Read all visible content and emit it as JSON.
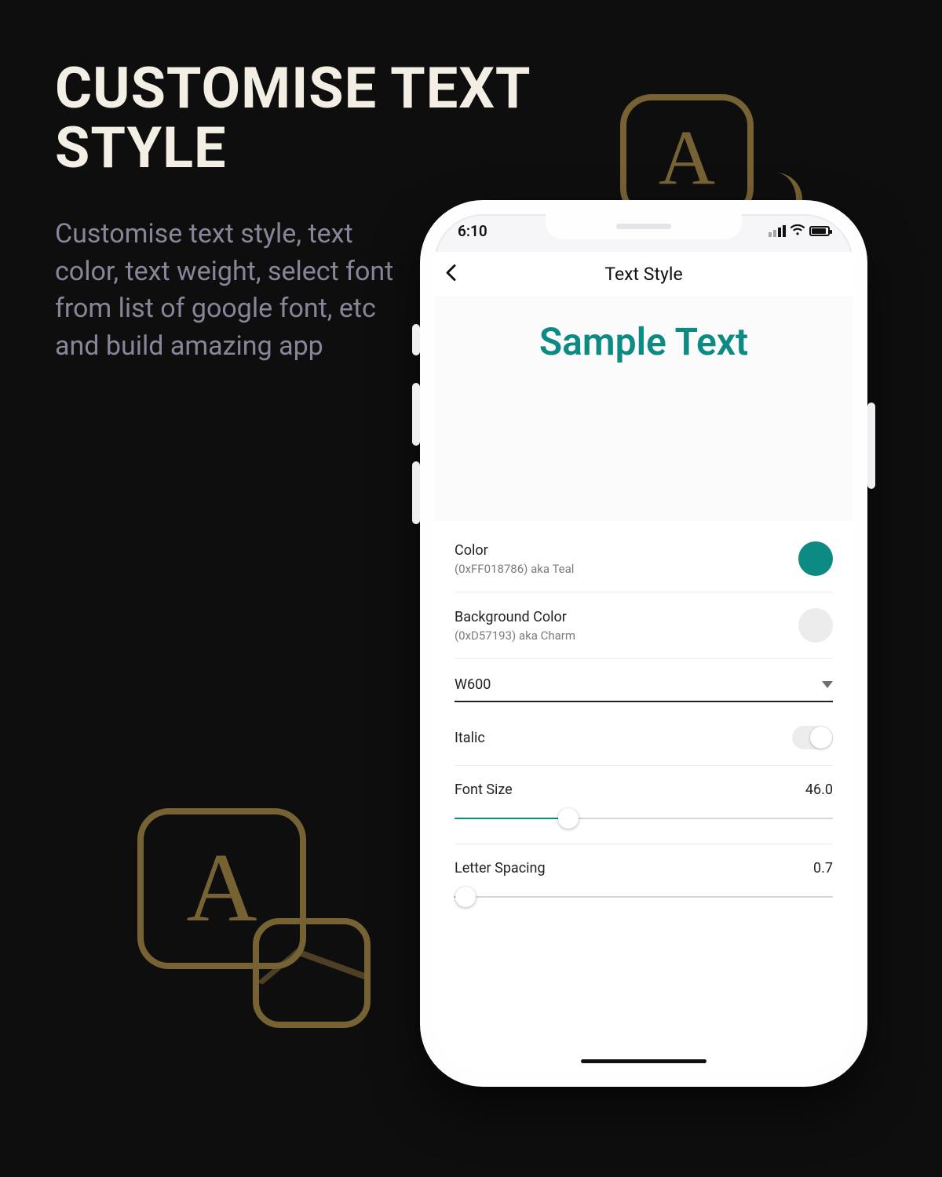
{
  "marketing": {
    "headline_l1": "CUSTOMISE TEXT",
    "headline_l2": "STYLE",
    "subcopy": "Customise text style, text color, text weight, select font from list of google font, etc and build amazing app"
  },
  "status": {
    "time": "6:10"
  },
  "app": {
    "title": "Text Style",
    "preview_text": "Sample Text"
  },
  "controls": {
    "color": {
      "label": "Color",
      "detail": "(0xFF018786) aka Teal",
      "swatch_hex": "#0d8b83"
    },
    "bg_color": {
      "label": "Background Color",
      "detail": "(0xD57193) aka Charm",
      "swatch_hex": "#ececec"
    },
    "weight_select": {
      "value": "W600"
    },
    "italic": {
      "label": "Italic",
      "value": false
    },
    "font_size": {
      "label": "Font Size",
      "value": "46.0",
      "slider_pct": 30
    },
    "letter_spacing": {
      "label": "Letter Spacing",
      "value": "0.7",
      "slider_pct": 3
    }
  }
}
